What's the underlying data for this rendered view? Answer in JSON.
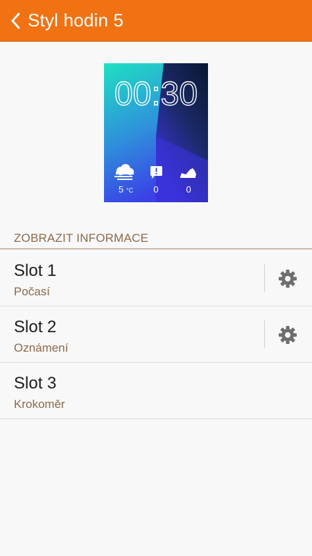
{
  "header": {
    "title": "Styl hodin 5",
    "back_icon": "chevron-left-icon",
    "background": "#f07213"
  },
  "watch_preview": {
    "time": "00:30",
    "weather_icon": "cloud-icon",
    "weather_value": "5",
    "weather_unit": "°C",
    "notification_icon": "notification-icon",
    "notification_value": "0",
    "steps_icon": "shoe-icon",
    "steps_value": "0"
  },
  "section": {
    "title": "ZOBRAZIT INFORMACE"
  },
  "slots": [
    {
      "title": "Slot 1",
      "subtitle": "Počasí",
      "has_settings": true
    },
    {
      "title": "Slot 2",
      "subtitle": "Oznámení",
      "has_settings": true
    },
    {
      "title": "Slot 3",
      "subtitle": "Krokoměr",
      "has_settings": false
    }
  ],
  "settings_icon": "gear-icon",
  "colors": {
    "accent": "#f07213",
    "secondary_text": "#8b6a4c",
    "section_rule": "#cbb9a7"
  }
}
